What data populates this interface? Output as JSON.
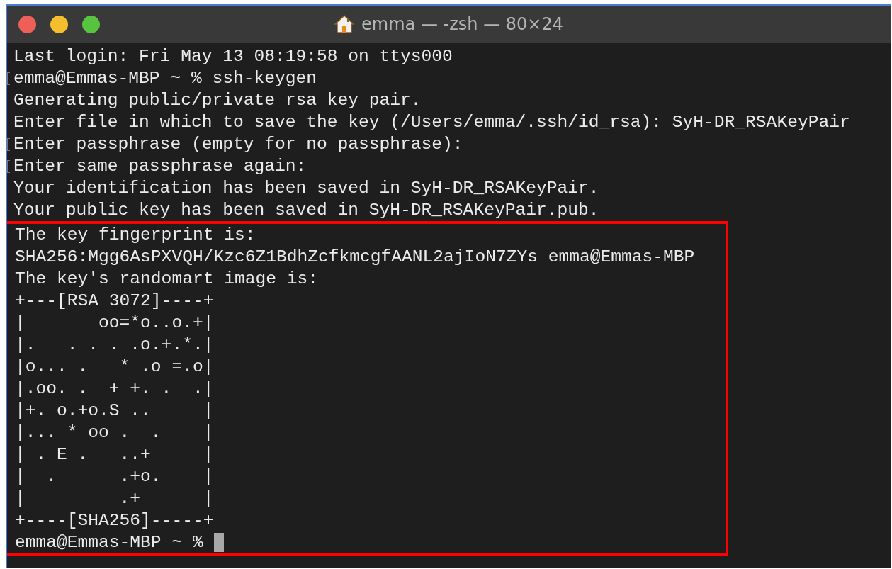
{
  "window": {
    "title": "emma — -zsh — 80×24"
  },
  "lines": [
    {
      "text": "Last login: Fri May 13 08:19:58 on ttys000",
      "marked": false
    },
    {
      "text": "emma@Emmas-MBP ~ % ssh-keygen",
      "marked": true
    },
    {
      "text": "Generating public/private rsa key pair.",
      "marked": false
    },
    {
      "text": "Enter file in which to save the key (/Users/emma/.ssh/id_rsa): SyH-DR_RSAKeyPair",
      "marked": false
    },
    {
      "text": "Enter passphrase (empty for no passphrase):",
      "marked": true
    },
    {
      "text": "Enter same passphrase again:",
      "marked": true
    },
    {
      "text": "Your identification has been saved in SyH-DR_RSAKeyPair.",
      "marked": false
    },
    {
      "text": "Your public key has been saved in SyH-DR_RSAKeyPair.pub.",
      "marked": false
    }
  ],
  "highlight": {
    "lines": [
      {
        "text": "The key fingerprint is:",
        "marked": false
      },
      {
        "text": "SHA256:Mgg6AsPXVQH/Kzc6Z1BdhZcfkmcgfAANL2ajIoN7ZYs emma@Emmas-MBP",
        "marked": false
      },
      {
        "text": "The key's randomart image is:",
        "marked": false
      },
      {
        "text": "+---[RSA 3072]----+",
        "marked": false
      },
      {
        "text": "|       oo=*o..o.+|",
        "marked": false
      },
      {
        "text": "|.   . . . .o.+.*.|",
        "marked": false
      },
      {
        "text": "|o... .   * .o =.o|",
        "marked": false
      },
      {
        "text": "|.oo. .  + +. .  .|",
        "marked": false
      },
      {
        "text": "|+. o.+o.S ..     |",
        "marked": false
      },
      {
        "text": "|... * oo .  .    |",
        "marked": false
      },
      {
        "text": "| . E .   ..+     |",
        "marked": false
      },
      {
        "text": "|  .      .+o.    |",
        "marked": false
      },
      {
        "text": "|         .+      |",
        "marked": false
      },
      {
        "text": "+----[SHA256]-----+",
        "marked": false
      }
    ],
    "prompt": {
      "text": "emma@Emmas-MBP ~ %",
      "cursor": true
    }
  }
}
